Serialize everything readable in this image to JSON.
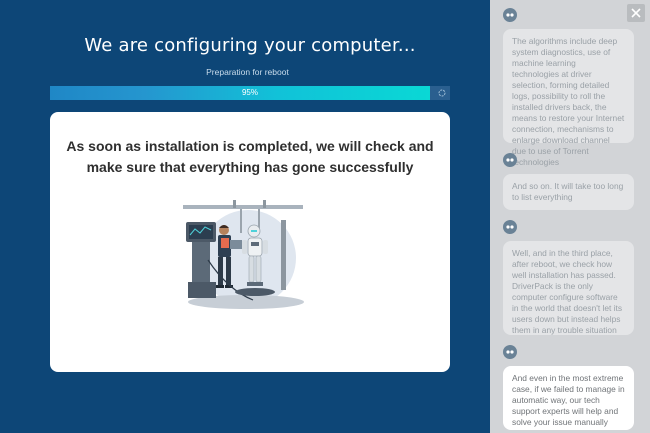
{
  "header": {
    "title": "We are configuring your computer...",
    "subtitle": "Preparation for reboot"
  },
  "progress": {
    "value": 95,
    "label": "95%"
  },
  "card": {
    "message": "As soon as installation is completed, we will check and make sure that everything has gone successfully",
    "illustration": "engineer-and-robot-illustration"
  },
  "chat": {
    "close_icon": "close-icon",
    "avatar_icon": "bot-avatar-icon",
    "messages": [
      "The algorithms include deep system diagnostics, use of machine learning technologies at driver selection, forming detailed logs, possibility to roll the installed drivers back, the means to restore your Internet connection, mechanisms to enlarge download channel due to use of Torrent technologies",
      "And so on. It will take too long to list everything",
      "Well, and in the third place, after reboot, we check how well installation has passed. DriverPack is the only computer configure software in the world that doesn't let its users down but instead helps them in any trouble situation",
      "And even in the most extreme case, if we failed to manage in automatic way, our tech support experts will help and solve your issue manually"
    ]
  },
  "colors": {
    "background": "#0d4677",
    "progress_start": "#1f87c6",
    "progress_end": "#0ad8d5",
    "panel": "#d2d4d7"
  }
}
